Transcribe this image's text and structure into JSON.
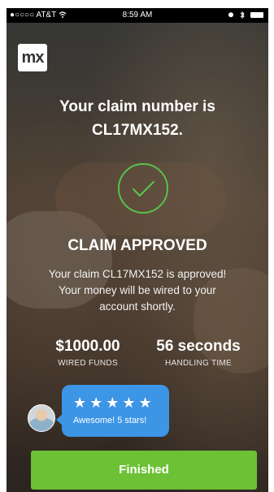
{
  "status_bar": {
    "carrier": "●○○○○ AT&T",
    "time": "8:59 AM"
  },
  "logo": {
    "text": "mx"
  },
  "claim": {
    "title_line1": "Your claim number is",
    "title_line2": "CL17MX152.",
    "status": "CLAIM APPROVED",
    "message": "Your claim CL17MX152 is approved! Your money will be wired to your account shortly."
  },
  "stats": {
    "funds_value": "$1000.00",
    "funds_label": "WIRED FUNDS",
    "time_value": "56 seconds",
    "time_label": "HANDLING TIME"
  },
  "review": {
    "rating": 5,
    "stars": "★★★★★",
    "text": "Awesome! 5 stars!"
  },
  "button": {
    "finish_label": "Finished"
  },
  "colors": {
    "accent_green": "#6cc135",
    "bubble_blue": "#3d95e6",
    "check_green": "#58c24b"
  },
  "icons": [
    "wifi-icon",
    "alarm-icon",
    "bluetooth-icon",
    "battery-icon",
    "check-circle-icon",
    "user-avatar"
  ]
}
